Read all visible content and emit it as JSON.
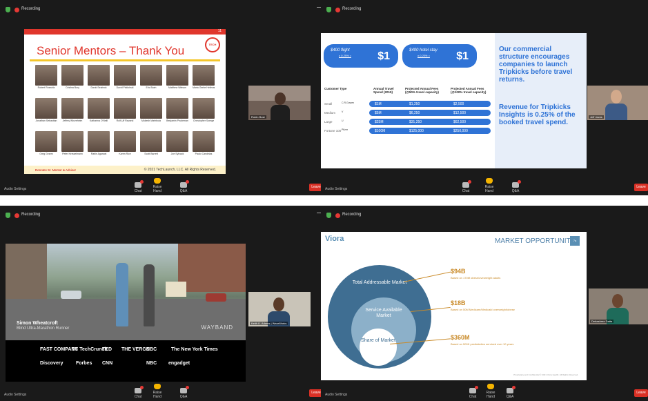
{
  "recording_label": "Recording",
  "bottom": {
    "audio": "Audio Settings",
    "chat": "Chat",
    "raise_hand": "Raise Hand",
    "qa": "Q&A",
    "leave": "Leave"
  },
  "q1": {
    "page_num": "11",
    "title": "Senior Mentors – Thank You",
    "logo_text": "TECH",
    "mentors": [
      "Robert Roswhiz",
      "Cristina Bury",
      "David Seabrok",
      "David Pistlohski",
      "Eric Bush",
      "Matthew Watson",
      "Maria Gerbe Heitmann",
      "Jonathan Sebastian",
      "Jeffrey Winzeheim",
      "Katharina O'Neill",
      "Rolf-Ulf Ravand",
      "Mukesh Marhbuta",
      "Benjamin Prudeman",
      "Christopher Soerge",
      "Greg Gearm",
      "Peter Kersselmann",
      "Rabin Agarwal",
      "Karen Rice",
      "Scott Barrett",
      "Joe Sylvack",
      "Paulo Candeias"
    ],
    "footer_left": "Denotes Sr. Mentor & Advisor",
    "footer_right": "© 2021 TechLaunch, LLC. All Rights Reserved.",
    "participant": "Robin Bost"
  },
  "q2": {
    "pill1_label": "$400 flight",
    "pill1_sub": "x 0.25% =",
    "pill1_value": "$1",
    "pill2_label": "$400 hotel stay",
    "pill2_sub": "x 0.25% =",
    "pill2_value": "$1",
    "statement1": "Our commercial structure encourages companies to launch Tripkicks before travel returns.",
    "statement2": "Revenue for Tripkicks Insights is 0.25% of the booked travel spend.",
    "headers": [
      "Customer Type",
      "Annual Travel Spend (2019)",
      "Projected Annual Fees (@50% travel capacity)",
      "Projected Annual Fees (@100% travel capacity)"
    ],
    "rows": [
      {
        "type": "Small",
        "brand": "C.R.Gowen",
        "spend": "$1M",
        "fee50": "$1,250",
        "fee100": "$2,500"
      },
      {
        "type": "Medium",
        "brand": "V",
        "spend": "$5M",
        "fee50": "$6,250",
        "fee100": "$12,500"
      },
      {
        "type": "Large",
        "brand": "U",
        "spend": "$25M",
        "fee50": "$31,250",
        "fee100": "$62,500"
      },
      {
        "type": "Fortune 100",
        "brand": "Pfizer",
        "spend": "$100M",
        "fee50": "$125,000",
        "fee100": "$250,000"
      }
    ],
    "participant": "Jeff Jacks"
  },
  "q3": {
    "caption_name": "Simon Wheatcroft",
    "caption_role": "Blind Ultra-Marathon Runner",
    "brand": "WAYBAND",
    "logos_row1": [
      "FAST COMPANY",
      "TC TechCrunch",
      "TED",
      "THE VERGE",
      "NBC",
      "The New York Times"
    ],
    "logos_row2": [
      "Discovery",
      "Forbes",
      "CNN",
      "",
      "NBC",
      "engadget"
    ],
    "participant": "Keith K. Adams | WearWorks"
  },
  "q4": {
    "logo": "Viora",
    "title": "MARKET OPPORTUNITY",
    "page_num": "7a",
    "tam_label": "Total Addressable Market",
    "sam_label": "Service Available Market",
    "som_label": "Share of Market",
    "tam_value": "$94B",
    "tam_desc": "Based on 170M obese/overweight adults",
    "sam_value": "$18B",
    "sam_desc": "Based on 50M Medicare/Medicaid overweight/obese",
    "som_value": "$360M",
    "som_desc": "Based on 500K prediabetics serviced over 10 years",
    "copyright": "Proprietary and Confidential © 2021 Viora Health. All Rights Reserved.",
    "participant": "Debashree Datta"
  }
}
